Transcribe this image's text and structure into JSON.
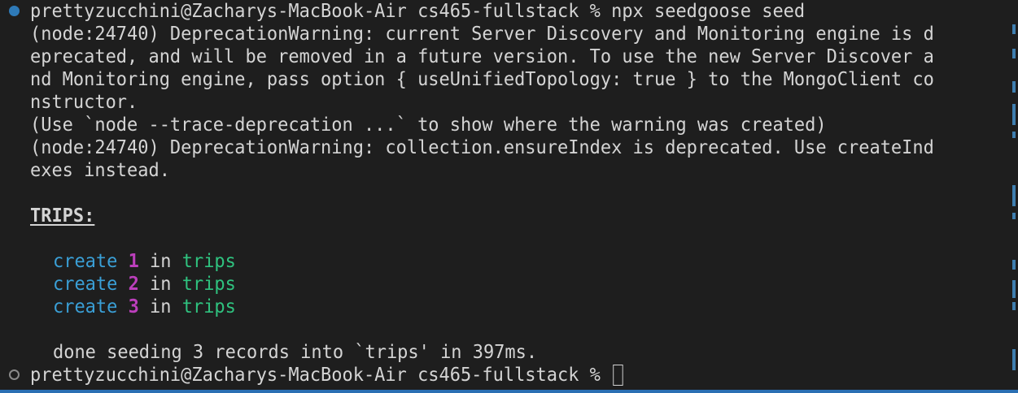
{
  "terminal": {
    "prompt": "prettyzucchini@Zacharys-MacBook-Air cs465-fullstack % ",
    "command": "npx seedgoose seed",
    "warnings": [
      "(node:24740) DeprecationWarning: current Server Discovery and Monitoring engine is d",
      "eprecated, and will be removed in a future version. To use the new Server Discover a",
      "nd Monitoring engine, pass option { useUnifiedTopology: true } to the MongoClient co",
      "nstructor.",
      "(Use `node --trace-deprecation ...` to show where the warning was created)",
      "(node:24740) DeprecationWarning: collection.ensureIndex is deprecated. Use createInd",
      "exes instead."
    ],
    "section_title": "TRIPS:",
    "creates": [
      {
        "verb": "create",
        "num": "1",
        "prep": "in",
        "target": "trips"
      },
      {
        "verb": "create",
        "num": "2",
        "prep": "in",
        "target": "trips"
      },
      {
        "verb": "create",
        "num": "3",
        "prep": "in",
        "target": "trips"
      }
    ],
    "done": "done seeding 3 records into `trips' in 397ms.",
    "prompt2": "prettyzucchini@Zacharys-MacBook-Air cs465-fullstack % "
  },
  "colors": {
    "background": "#1e1e1e",
    "text": "#d4d4d4",
    "create": "#3a9fd6",
    "number": "#bc3fbc",
    "trips": "#2fc27f",
    "status_bar": "#2a6fb3"
  }
}
